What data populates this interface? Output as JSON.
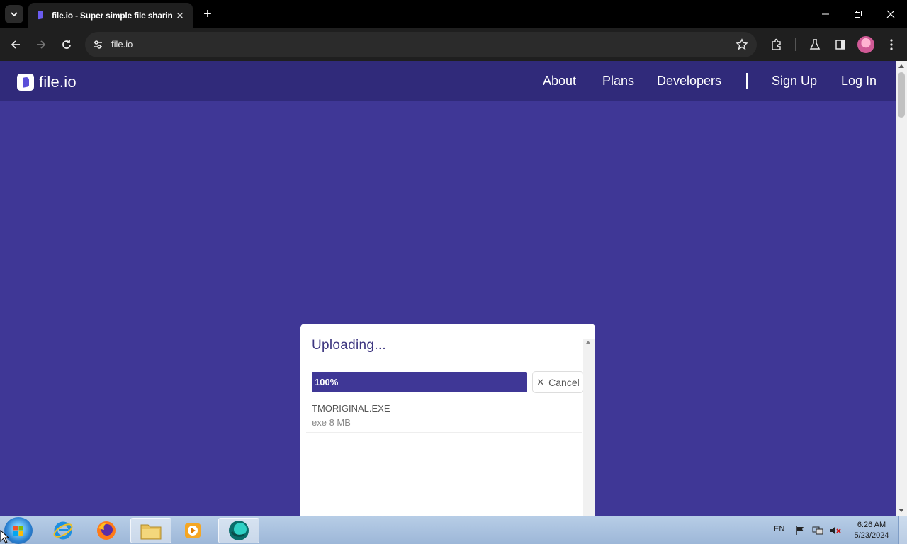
{
  "browser": {
    "tab_title": "file.io - Super simple file sharing!",
    "address": "file.io"
  },
  "site": {
    "logo_text": "file.io",
    "nav": {
      "about": "About",
      "plans": "Plans",
      "developers": "Developers",
      "sign_up": "Sign Up",
      "log_in": "Log In"
    }
  },
  "upload": {
    "title": "Uploading...",
    "progress": 1.0,
    "progress_label": "100%",
    "cancel_label": "Cancel",
    "files": [
      {
        "name": "TMORIGINAL.EXE",
        "meta": "exe 8 MB"
      }
    ]
  },
  "taskbar": {
    "language": "EN",
    "time": "6:26 AM",
    "date": "5/23/2024"
  },
  "colors": {
    "page_bg": "#3f3796",
    "header_bg": "#302a7a",
    "accent": "#3f3796"
  },
  "icons": {
    "tab_search": "chevron-down-icon",
    "back": "arrow-left-icon",
    "forward": "arrow-right-icon",
    "reload": "reload-icon",
    "site_info": "tune-icon",
    "bookmark": "star-icon",
    "extensions": "puzzle-icon",
    "labs": "flask-icon",
    "side_panel": "side-panel-icon",
    "menu": "kebab-menu-icon"
  }
}
